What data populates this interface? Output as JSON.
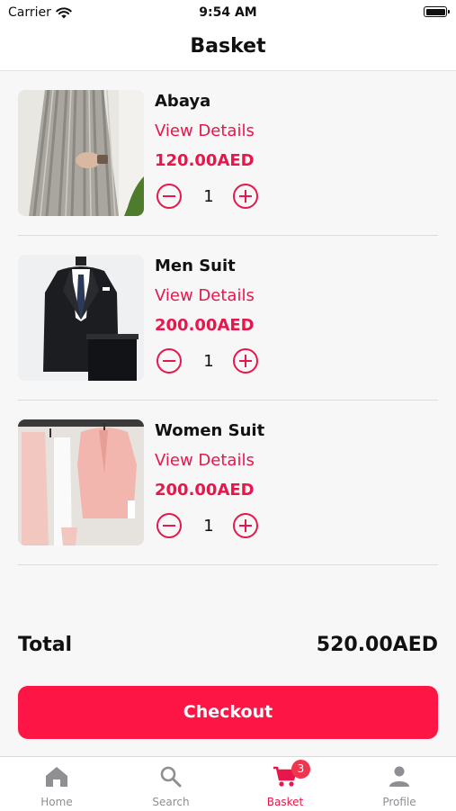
{
  "status_bar": {
    "carrier": "Carrier",
    "time": "9:54 AM"
  },
  "header": {
    "title": "Basket"
  },
  "items": [
    {
      "name": "Abaya",
      "details_label": "View Details",
      "price": "120.00AED",
      "quantity": "1"
    },
    {
      "name": "Men Suit",
      "details_label": "View Details",
      "price": "200.00AED",
      "quantity": "1"
    },
    {
      "name": "Women Suit",
      "details_label": "View Details",
      "price": "200.00AED",
      "quantity": "1"
    }
  ],
  "summary": {
    "total_label": "Total",
    "total_value": "520.00AED"
  },
  "checkout": {
    "label": "Checkout"
  },
  "tab_bar": {
    "tabs": [
      {
        "label": "Home",
        "icon": "home-icon"
      },
      {
        "label": "Search",
        "icon": "search-icon"
      },
      {
        "label": "Basket",
        "icon": "cart-icon",
        "badge": "3",
        "active": true
      },
      {
        "label": "Profile",
        "icon": "person-icon"
      }
    ]
  },
  "colors": {
    "accent": "#e8174b",
    "checkout": "#fd1545",
    "inactive_tab": "#8e8e93"
  }
}
